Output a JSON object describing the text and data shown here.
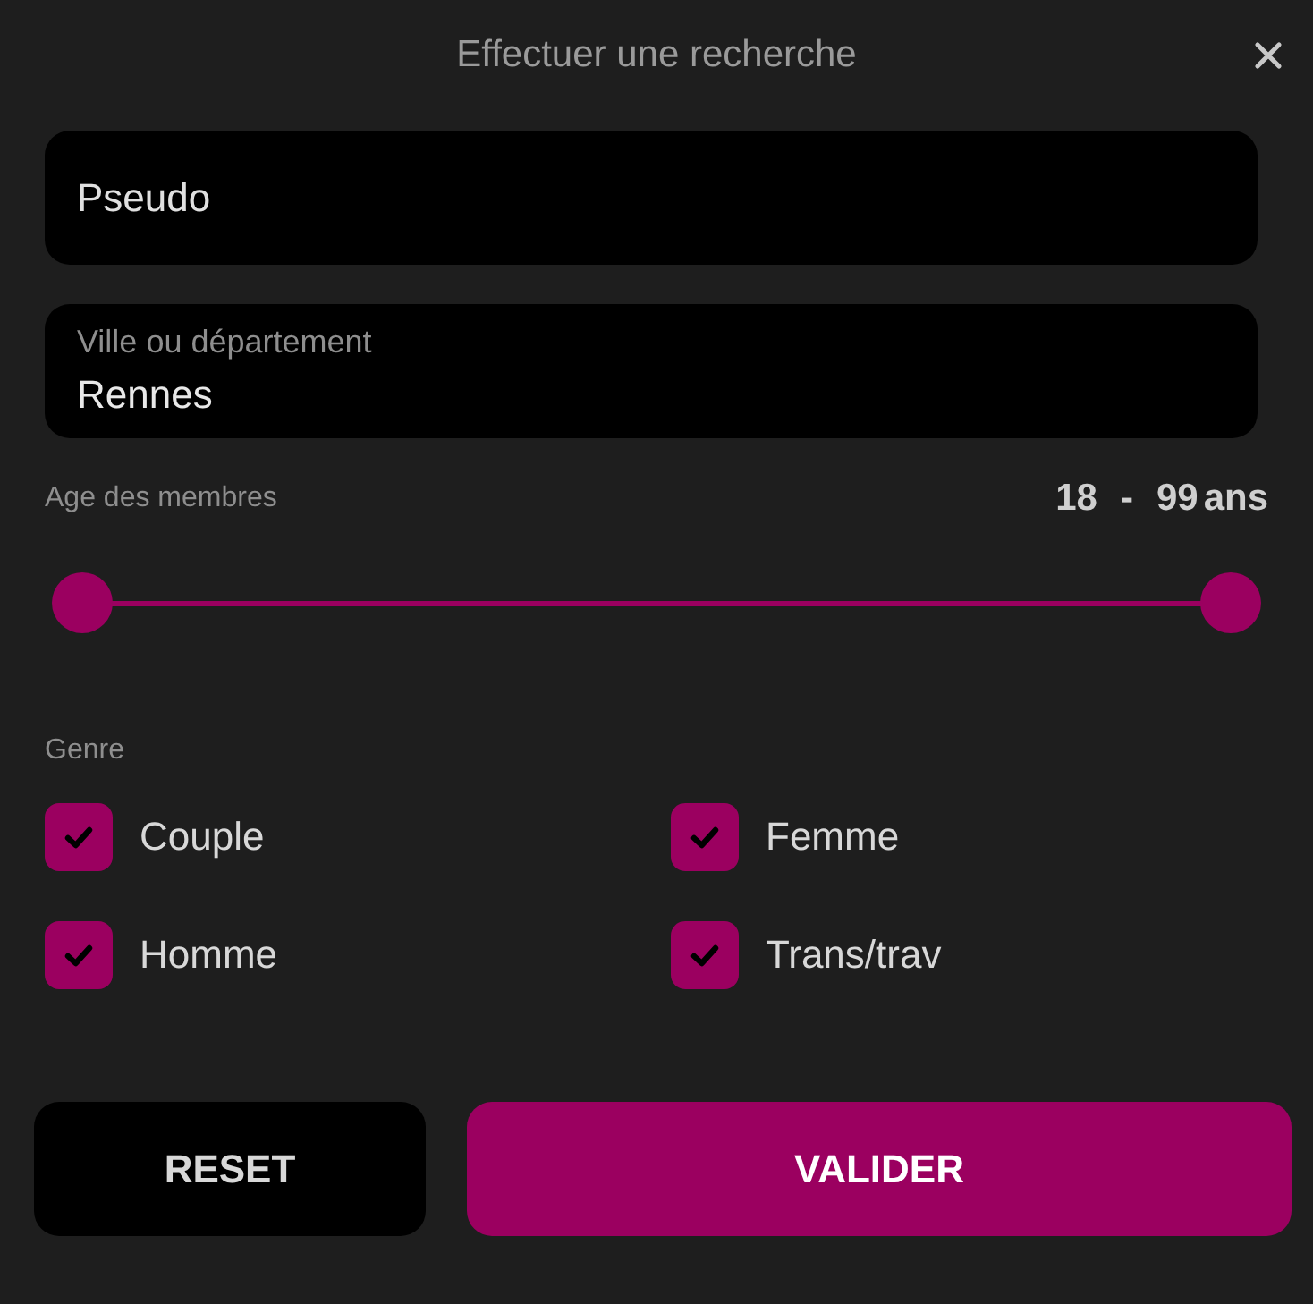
{
  "dialog": {
    "title": "Effectuer une recherche"
  },
  "fields": [
    {
      "kind": "placeholder",
      "placeholder": "Pseudo"
    },
    {
      "kind": "labeled",
      "label": "Ville ou département",
      "value": "Rennes"
    }
  ],
  "age": {
    "label": "Age des membres",
    "min": "18",
    "separator": "-",
    "max": "99",
    "unit": "ans",
    "thumbs": [
      {
        "level": 0
      },
      {
        "level": 1
      }
    ]
  },
  "genre": {
    "label": "Genre",
    "options": [
      {
        "label": "Couple",
        "checked": true
      },
      {
        "label": "Femme",
        "checked": true
      },
      {
        "label": "Homme",
        "checked": true
      },
      {
        "label": "Trans/trav",
        "checked": true
      }
    ]
  },
  "buttons": [
    {
      "label": "RESET",
      "kind": "secondary"
    },
    {
      "label": "VALIDER",
      "kind": "primary"
    }
  ]
}
